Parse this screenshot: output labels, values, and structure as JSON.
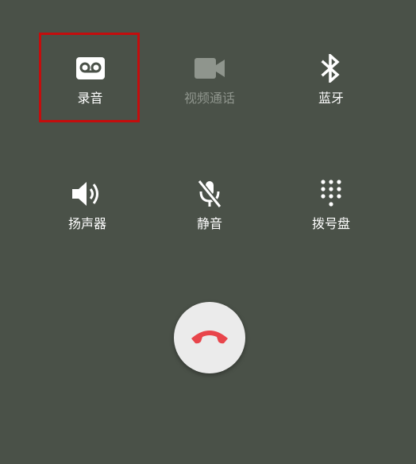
{
  "call_controls": {
    "record": {
      "label": "录音",
      "icon": "voicemail-icon",
      "highlighted": true
    },
    "video_call": {
      "label": "视频通话",
      "icon": "videocam-icon",
      "enabled": false
    },
    "bluetooth": {
      "label": "蓝牙",
      "icon": "bluetooth-icon"
    },
    "speaker": {
      "label": "扬声器",
      "icon": "speaker-icon"
    },
    "mute": {
      "label": "静音",
      "icon": "mic-off-icon"
    },
    "dialpad": {
      "label": "拨号盘",
      "icon": "dialpad-icon"
    }
  },
  "end_call": {
    "icon": "call-end-icon",
    "color": "#e8454b"
  },
  "colors": {
    "background": "#4a5148",
    "label": "#ffffff",
    "disabled_label": "#8f958d",
    "highlight_border": "#c40d0d",
    "end_call_button": "#ebebeb"
  }
}
